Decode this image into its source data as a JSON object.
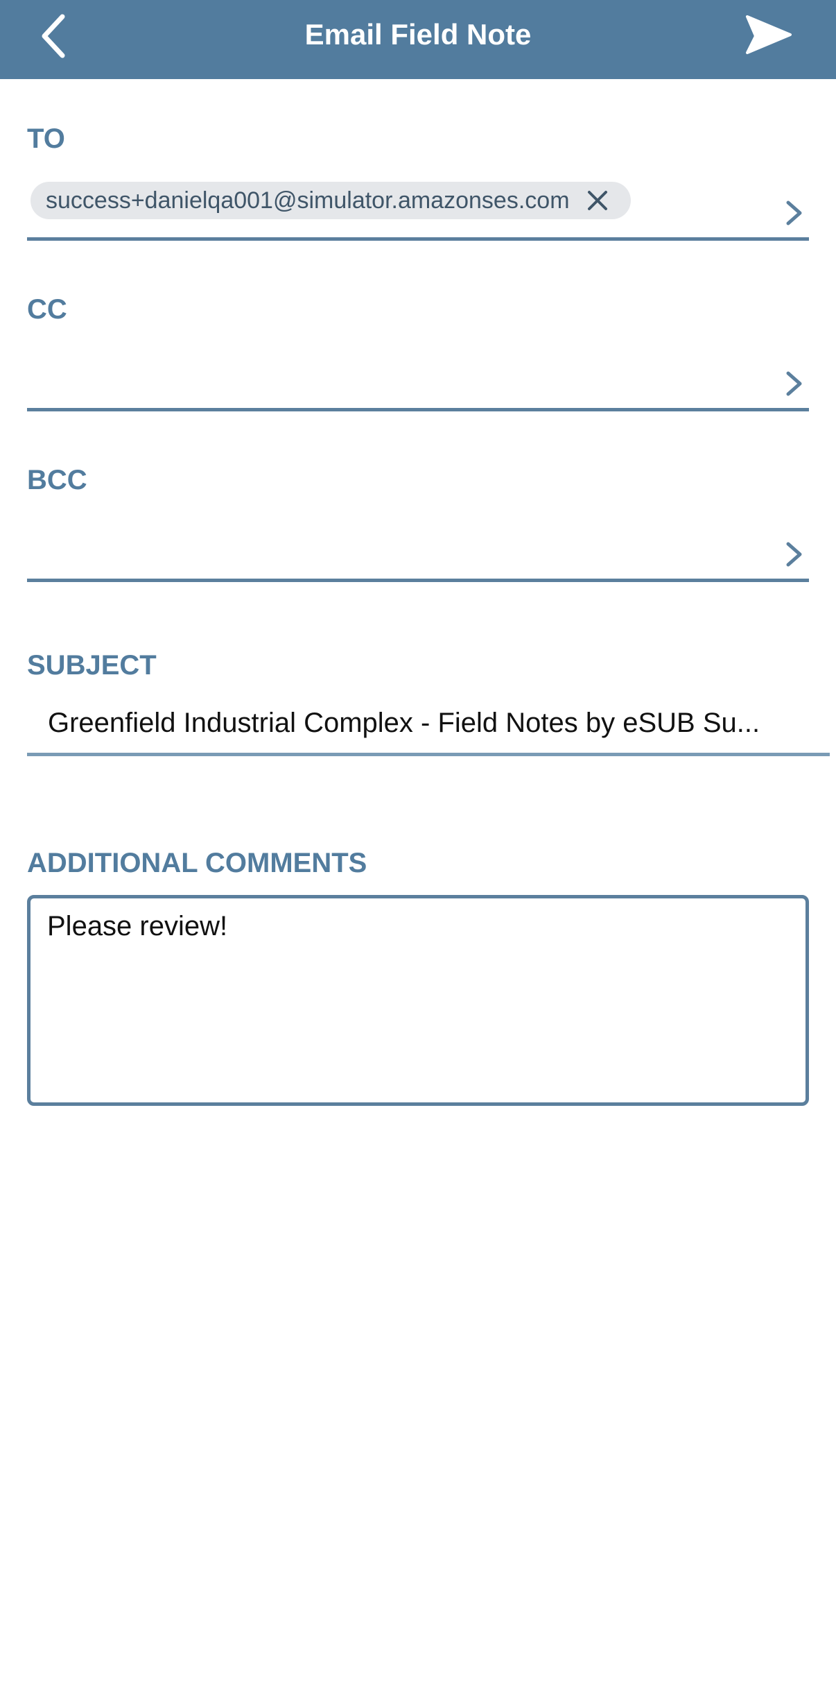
{
  "header": {
    "title": "Email Field Note",
    "back_icon": "chevron-left-icon",
    "send_icon": "send-icon",
    "color": "#527c9e"
  },
  "to": {
    "label": "TO",
    "recipients": [
      {
        "email": "success+danielqa001@simulator.amazonses.com"
      }
    ]
  },
  "cc": {
    "label": "CC"
  },
  "bcc": {
    "label": "BCC"
  },
  "subject": {
    "label": "SUBJECT",
    "value": "Greenfield Industrial Complex - Field Notes by eSUB Su..."
  },
  "comments": {
    "label": "ADDITIONAL COMMENTS",
    "value": "Please review!"
  },
  "colors": {
    "accent": "#527c9e",
    "border": "#5b7f9d",
    "chip_bg": "#e5e7ea"
  }
}
